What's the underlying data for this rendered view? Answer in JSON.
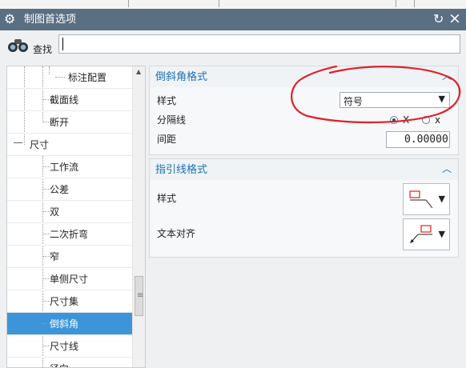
{
  "window": {
    "title": "制图首选项"
  },
  "search": {
    "label": "查找",
    "value": ""
  },
  "tree": {
    "items": [
      {
        "label": "标注配置",
        "level": 3
      },
      {
        "label": "截面线",
        "level": 2
      },
      {
        "label": "断开",
        "level": 2
      },
      {
        "label": "尺寸",
        "level": 1
      },
      {
        "label": "工作流",
        "level": 2
      },
      {
        "label": "公差",
        "level": 2
      },
      {
        "label": "双",
        "level": 2
      },
      {
        "label": "二次折弯",
        "level": 2
      },
      {
        "label": "窄",
        "level": 2
      },
      {
        "label": "单侧尺寸",
        "level": 2
      },
      {
        "label": "尺寸集",
        "level": 2
      },
      {
        "label": "倒斜角",
        "level": 2,
        "selected": true
      },
      {
        "label": "尺寸线",
        "level": 2
      },
      {
        "label": "径向",
        "level": 2
      }
    ]
  },
  "chamfer_format": {
    "title": "倒斜角格式",
    "style_label": "样式",
    "style_value": "符号",
    "separator_label": "分隔线",
    "separator_options": [
      {
        "label": "X",
        "selected": true
      },
      {
        "label": "x",
        "selected": false
      }
    ],
    "spacing_label": "间距",
    "spacing_value": "0.00000"
  },
  "leader_format": {
    "title": "指引线格式",
    "style_label": "样式",
    "text_align_label": "文本对齐"
  },
  "colors": {
    "titlebar": "#5b6f82",
    "accent": "#1b6fb5",
    "selection": "#3d95d9",
    "annotation": "#e0202a"
  }
}
